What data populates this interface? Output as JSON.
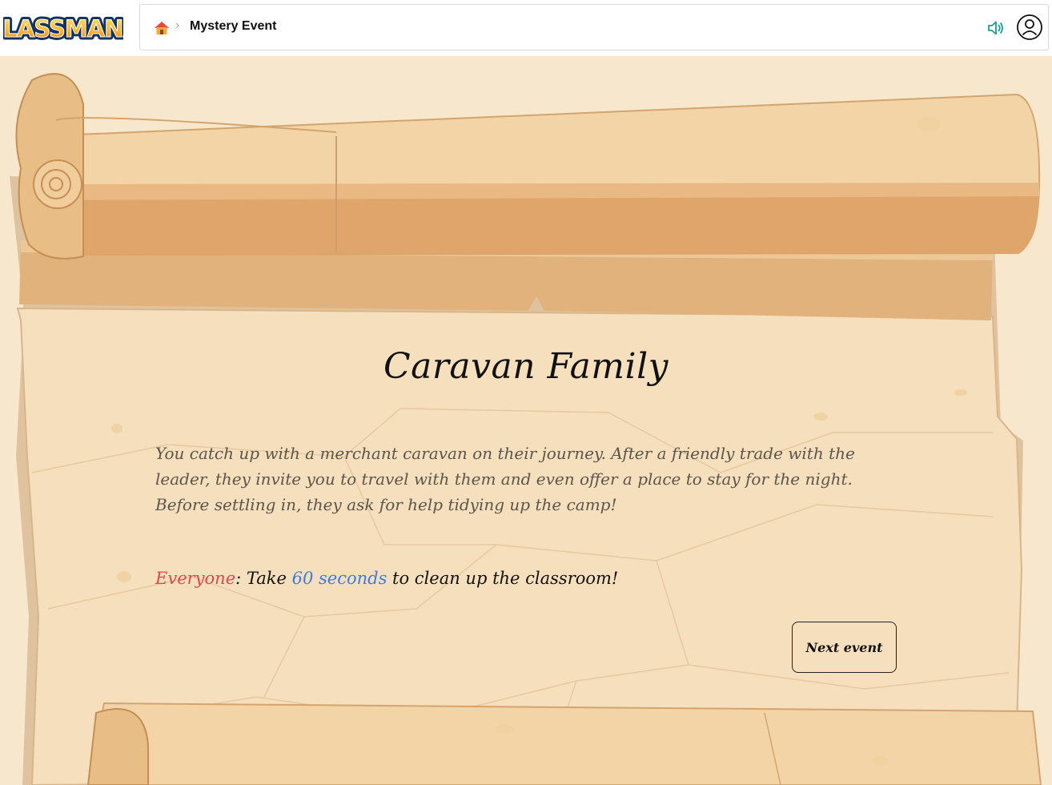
{
  "app": {
    "logo_text": "CLASSMANA"
  },
  "breadcrumb": {
    "home_icon": "home-icon",
    "separator": "›",
    "current": "Mystery Event"
  },
  "header_actions": {
    "sound_icon": "speaker-icon",
    "profile_icon": "user-icon"
  },
  "event": {
    "title": "Caravan Family",
    "description": "You catch up with a merchant caravan on their journey. After a friendly trade with the leader, they invite you to travel with them and even offer a place to stay for the night. Before settling in, they ask for help tidying up the camp!",
    "task_target": "Everyone",
    "task_colon": ": Take ",
    "task_duration": "60 seconds",
    "task_rest": " to clean up the classroom!",
    "next_label": "Next event"
  },
  "colors": {
    "parchment": "#f6e7cd",
    "target_red": "#e0474c",
    "duration_blue": "#3f7ae0",
    "sound_teal": "#1a9e8f"
  }
}
